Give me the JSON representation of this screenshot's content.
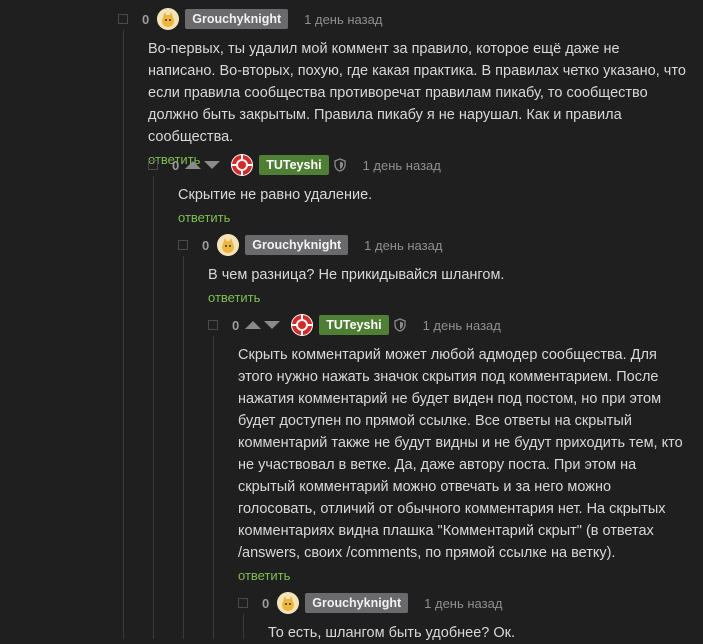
{
  "comments": [
    {
      "rating": "0",
      "author": "Grouchyknight",
      "time": "1 день назад",
      "text": "Во-первых, ты удалил мой коммент за правило, которое ещё даже не написано. Во-вторых, похую, где какая практика. В правилах четко указано, что если правила сообщества противоречат правилам пикабу, то сообщество должно быть закрытым. Правила пикабу я не нарушал. Как и правила сообщества.",
      "reply": "ответить"
    },
    {
      "rating": "0",
      "author": "TUTeyshi",
      "time": "1 день назад",
      "text": "Скрытие не равно удаление.",
      "reply": "ответить"
    },
    {
      "rating": "0",
      "author": "Grouchyknight",
      "time": "1 день назад",
      "text": "В чем разница? Не прикидывайся шлангом.",
      "reply": "ответить"
    },
    {
      "rating": "0",
      "author": "TUTeyshi",
      "time": "1 день назад",
      "text": "Скрыть комментарий может любой адмодер сообщества. Для этого нужно нажать значок скрытия под комментарием. После нажатия комментарий не будет виден под постом, но при этом будет доступен по прямой ссылке. Все ответы на скрытый комментарий также не будут видны и не будут приходить тем, кто не участвовал в ветке. Да, даже автору поста. При этом на скрытый комментарий можно отвечать и за него можно голосовать, отличий от обычного комментария нет. На скрытых комментариях видна плашка \"Комментарий скрыт\" (в ответах /answers, своих /comments, по прямой ссылке на ветку).",
      "reply": "ответить"
    },
    {
      "rating": "0",
      "author": "Grouchyknight",
      "time": "1 день назад",
      "text": "То есть, шлангом быть удобнее? Ок."
    }
  ],
  "icons": {
    "collapse": "collapse-square-icon",
    "upvote": "upvote-arrow-icon",
    "downvote": "downvote-arrow-icon",
    "shield": "shield-icon",
    "avatar_grouchy": "cat-avatar-icon",
    "avatar_tut": "poker-chip-avatar-icon"
  },
  "colors": {
    "background": "#1f1f20",
    "reply_link": "#7fbf50",
    "author_badge_gray": "#6a6a6c",
    "author_badge_green": "#4f7f34",
    "text": "#d8d8d8",
    "muted": "#8f8f8f"
  }
}
